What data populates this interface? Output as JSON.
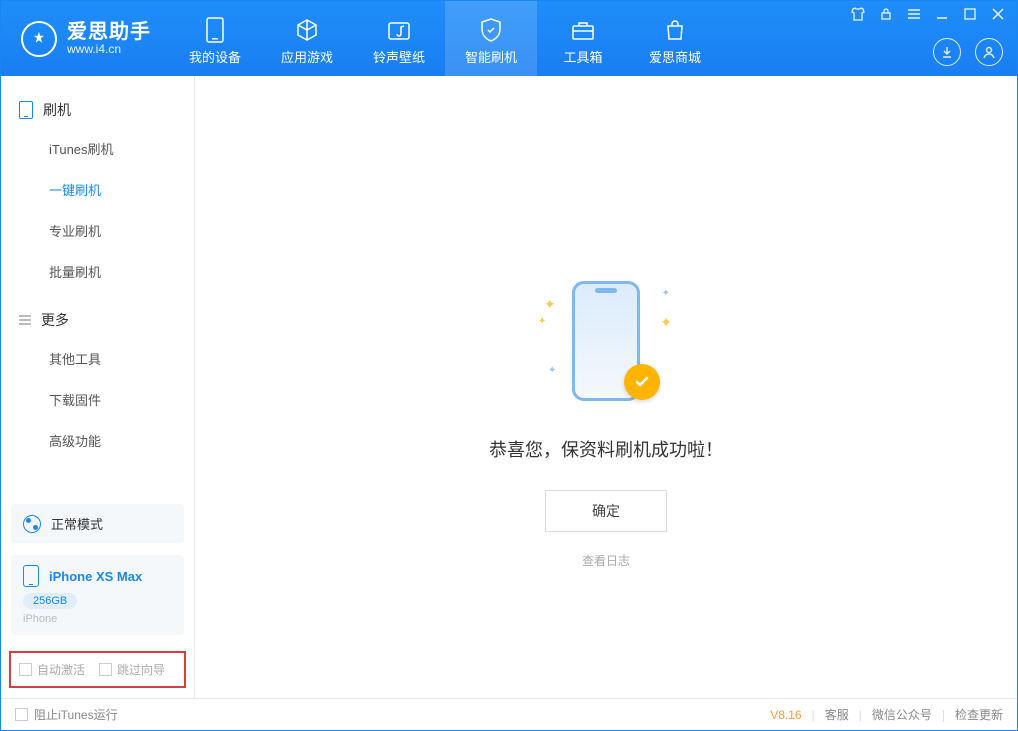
{
  "logo": {
    "main": "爱思助手",
    "sub": "www.i4.cn"
  },
  "nav": {
    "tabs": [
      {
        "label": "我的设备"
      },
      {
        "label": "应用游戏"
      },
      {
        "label": "铃声壁纸"
      },
      {
        "label": "智能刷机"
      },
      {
        "label": "工具箱"
      },
      {
        "label": "爱思商城"
      }
    ]
  },
  "sidebar": {
    "section1": "刷机",
    "items1": [
      {
        "label": "iTunes刷机"
      },
      {
        "label": "一键刷机"
      },
      {
        "label": "专业刷机"
      },
      {
        "label": "批量刷机"
      }
    ],
    "section2": "更多",
    "items2": [
      {
        "label": "其他工具"
      },
      {
        "label": "下载固件"
      },
      {
        "label": "高级功能"
      }
    ],
    "mode": "正常模式",
    "device": {
      "name": "iPhone XS Max",
      "capacity": "256GB",
      "type": "iPhone"
    },
    "opts": {
      "auto_activate": "自动激活",
      "skip_guide": "跳过向导"
    }
  },
  "main": {
    "success_msg": "恭喜您，保资料刷机成功啦！",
    "ok": "确定",
    "view_log": "查看日志"
  },
  "footer": {
    "block_itunes": "阻止iTunes运行",
    "version": "V8.16",
    "links": {
      "service": "客服",
      "wechat": "微信公众号",
      "update": "检查更新"
    }
  }
}
